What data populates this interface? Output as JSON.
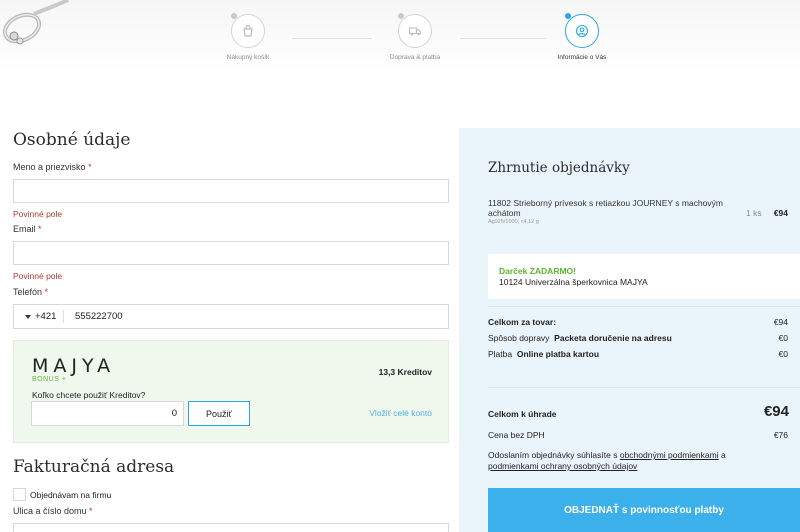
{
  "steps": [
    {
      "label": "Nákupný košík",
      "icon": "bag-icon",
      "active": false
    },
    {
      "label": "Doprava & platba",
      "icon": "truck-icon",
      "active": false
    },
    {
      "label": "Informácie o Vás",
      "icon": "user-icon",
      "active": true
    }
  ],
  "personal": {
    "title": "Osobné údaje",
    "name_label": "Meno a priezvisko",
    "name_value": "",
    "required_mark": "*",
    "name_error": "Povinné pole",
    "email_label": "Email",
    "email_value": "",
    "email_error": "Povinné pole",
    "phone_label": "Telefón",
    "phone_country_code": "+421",
    "phone_value": "555222700"
  },
  "bonus": {
    "brand": "MAJYA",
    "sub": "BONUS +",
    "credits": "13,3 Kreditov",
    "question": "Koľko chcete použiť Kreditov?",
    "input_value": "0",
    "use_label": "Použiť",
    "all_link": "Vložiť celé konto"
  },
  "billing": {
    "title": "Fakturačná adresa",
    "company_label": "Objednávam na firmu",
    "street_label": "Ulica a číslo domu",
    "required_mark": "*"
  },
  "summary": {
    "title": "Zhrnutie objednávky",
    "product_name": "11802 Strieborný prívesok s retiazkou JOURNEY s machovým achátom",
    "product_sub": "Ag925/1000; c4,12 g",
    "qty": "1 ks",
    "price": "€94",
    "gift_title": "Darček ZADARMO!",
    "gift_name": "10124 Univerzálna šperkovnica MAJYA",
    "goods_label": "Celkom za tovar:",
    "goods_value": "€94",
    "shipping_prefix": "Spôsob dopravy",
    "shipping_method": "Packeta doručenie na adresu",
    "shipping_value": "€0",
    "payment_prefix": "Platba",
    "payment_method": "Online platba kartou",
    "payment_value": "€0",
    "total_label": "Celkom k úhrade",
    "total_value": "€94",
    "net_label": "Cena bez DPH",
    "net_value": "€76",
    "terms_prefix": "Odoslaním objednávky súhlasíte s",
    "terms_link1": "obchodnými podmienkami",
    "terms_and": "a",
    "terms_link2": "podmienkami ochrany osobných údajov",
    "order_button": "OBJEDNAŤ s povinnosťou platby"
  },
  "colors": {
    "accent": "#3cb0ea",
    "error": "#b03a2e",
    "bonus_green": "#64b543",
    "summary_bg": "#eaf5fb"
  }
}
